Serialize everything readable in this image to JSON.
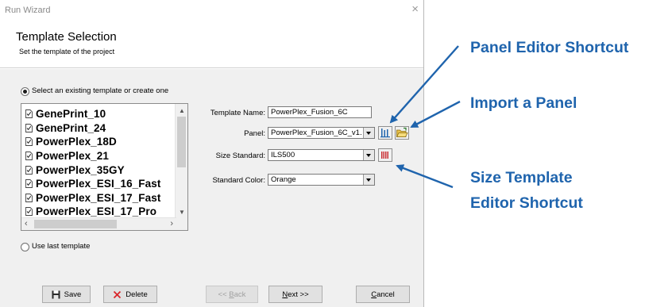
{
  "window": {
    "title": "Run Wizard",
    "close_glyph": "×"
  },
  "header": {
    "title": "Template Selection",
    "subtitle": "Set the template of the project"
  },
  "template_option": {
    "label": "Select an existing template or create one",
    "selected": true
  },
  "template_list": {
    "items": [
      "GenePrint_10",
      "GenePrint_24",
      "PowerPlex_18D",
      "PowerPlex_21",
      "PowerPlex_35GY",
      "PowerPlex_ESI_16_Fast",
      "PowerPlex_ESI_17_Fast",
      "PowerPlex_ESI_17_Pro"
    ]
  },
  "last_template_option": {
    "label": "Use last template",
    "selected": false
  },
  "fields": {
    "template_name": {
      "label": "Template Name:",
      "value": "PowerPlex_Fusion_6C"
    },
    "panel": {
      "label": "Panel:",
      "value": "PowerPlex_Fusion_6C_v1."
    },
    "size_standard": {
      "label": "Size Standard:",
      "value": "ILS500"
    },
    "standard_color": {
      "label": "Standard Color:",
      "value": "Orange"
    }
  },
  "buttons": {
    "save": "Save",
    "delete": "Delete",
    "back": "<< Back",
    "next": "Next >>",
    "cancel": "Cancel"
  },
  "annotations": {
    "panel_editor": "Panel Editor Shortcut",
    "import_panel": "Import a Panel",
    "size_template_line1": "Size Template",
    "size_template_line2": "Editor Shortcut"
  },
  "colors": {
    "annotation": "#1f64ad",
    "delete_x": "#d9262a",
    "editor_icon": "#1f64ad",
    "size_icon": "#c8242a"
  },
  "icons": {
    "panel_editor": "bar-chart-icon",
    "import_panel": "open-folder-icon",
    "size_editor": "red-bars-icon",
    "save": "floppy-disk-icon",
    "delete": "red-x-icon"
  }
}
